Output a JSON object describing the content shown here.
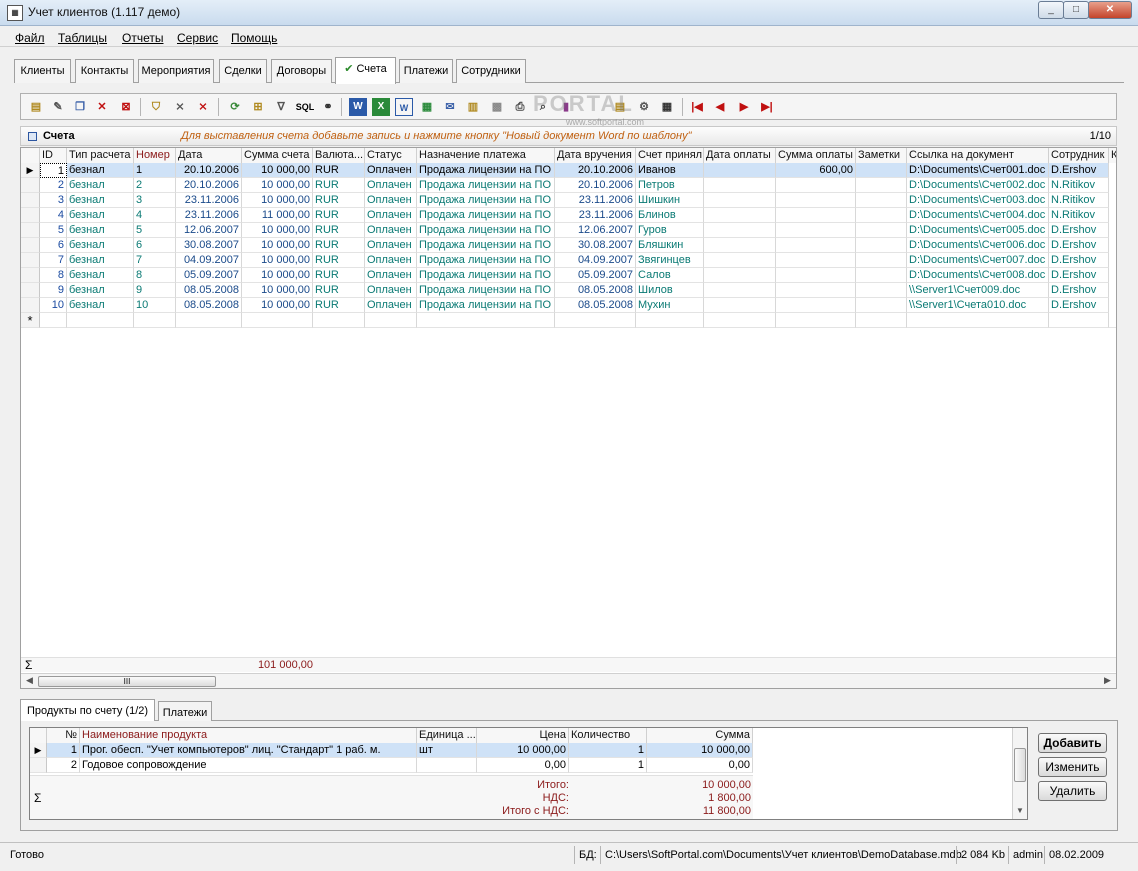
{
  "window": {
    "title": "Учет клиентов (1.117 демо)"
  },
  "menu": [
    "Файл",
    "Таблицы",
    "Отчеты",
    "Сервис",
    "Помощь"
  ],
  "tabs": [
    {
      "label": "Клиенты"
    },
    {
      "label": "Контакты"
    },
    {
      "label": "Мероприятия"
    },
    {
      "label": "Сделки"
    },
    {
      "label": "Договоры"
    },
    {
      "label": "Счета",
      "active": true
    },
    {
      "label": "Платежи"
    },
    {
      "label": "Сотрудники"
    }
  ],
  "toolbar_icons": [
    "new-icon",
    "edit-icon",
    "copy-icon",
    "delete-icon",
    "delete-all-icon",
    "filter-icon",
    "filter-clear-icon",
    "filter-remove-icon",
    "refresh-icon",
    "tree-icon",
    "filter-funnel-icon",
    "sql-icon",
    "binoculars-icon",
    "word-icon",
    "excel-icon",
    "word-template-icon",
    "export-icon",
    "mail-icon",
    "notes-icon",
    "grid-icon",
    "print-icon",
    "preview-icon",
    "chart-icon",
    "layout-icon",
    "settings-icon",
    "table-icon",
    "first-record-icon",
    "prev-record-icon",
    "next-record-icon",
    "last-record-icon"
  ],
  "watermark": {
    "text": "PORTAL",
    "url": "www.softportal.com"
  },
  "invoices": {
    "title": "Счета",
    "hint": "Для выставления счета добавьте запись и нажмите кнопку \"Новый документ Word по шаблону\"",
    "counter": "1/10",
    "columns": [
      "ID",
      "Тип расчета",
      "Номер",
      "Дата",
      "Сумма счета",
      "Валюта...",
      "Статус",
      "Назначение платежа",
      "Дата вручения",
      "Счет принял",
      "Дата оплаты",
      "Сумма оплаты",
      "Заметки",
      "Ссылка на документ",
      "Сотрудник",
      "К"
    ],
    "rows": [
      [
        "1",
        "безнал",
        "1",
        "20.10.2006",
        "10 000,00",
        "RUR",
        "Оплачен",
        "Продажа лицензии на ПО",
        "20.10.2006",
        "Иванов",
        "",
        "600,00",
        "",
        "D:\\Documents\\Счет001.doc",
        "D.Ershov"
      ],
      [
        "2",
        "безнал",
        "2",
        "20.10.2006",
        "10 000,00",
        "RUR",
        "Оплачен",
        "Продажа лицензии на ПО",
        "20.10.2006",
        "Петров",
        "",
        "",
        "",
        "D:\\Documents\\Счет002.doc",
        "N.Ritikov"
      ],
      [
        "3",
        "безнал",
        "3",
        "23.11.2006",
        "10 000,00",
        "RUR",
        "Оплачен",
        "Продажа лицензии на ПО",
        "23.11.2006",
        "Шишкин",
        "",
        "",
        "",
        "D:\\Documents\\Счет003.doc",
        "N.Ritikov"
      ],
      [
        "4",
        "безнал",
        "4",
        "23.11.2006",
        "11 000,00",
        "RUR",
        "Оплачен",
        "Продажа лицензии на ПО",
        "23.11.2006",
        "Блинов",
        "",
        "",
        "",
        "D:\\Documents\\Счет004.doc",
        "N.Ritikov"
      ],
      [
        "5",
        "безнал",
        "5",
        "12.06.2007",
        "10 000,00",
        "RUR",
        "Оплачен",
        "Продажа лицензии на ПО",
        "12.06.2007",
        "Гуров",
        "",
        "",
        "",
        "D:\\Documents\\Счет005.doc",
        "D.Ershov"
      ],
      [
        "6",
        "безнал",
        "6",
        "30.08.2007",
        "10 000,00",
        "RUR",
        "Оплачен",
        "Продажа лицензии на ПО",
        "30.08.2007",
        "Бляшкин",
        "",
        "",
        "",
        "D:\\Documents\\Счет006.doc",
        "D.Ershov"
      ],
      [
        "7",
        "безнал",
        "7",
        "04.09.2007",
        "10 000,00",
        "RUR",
        "Оплачен",
        "Продажа лицензии на ПО",
        "04.09.2007",
        "Звягинцев",
        "",
        "",
        "",
        "D:\\Documents\\Счет007.doc",
        "D.Ershov"
      ],
      [
        "8",
        "безнал",
        "8",
        "05.09.2007",
        "10 000,00",
        "RUR",
        "Оплачен",
        "Продажа лицензии на ПО",
        "05.09.2007",
        "Салов",
        "",
        "",
        "",
        "D:\\Documents\\Счет008.doc",
        "D.Ershov"
      ],
      [
        "9",
        "безнал",
        "9",
        "08.05.2008",
        "10 000,00",
        "RUR",
        "Оплачен",
        "Продажа лицензии на ПО",
        "08.05.2008",
        "Шилов",
        "",
        "",
        "",
        "\\\\Server1\\Счет009.doc",
        "D.Ershov"
      ],
      [
        "10",
        "безнал",
        "10",
        "08.05.2008",
        "10 000,00",
        "RUR",
        "Оплачен",
        "Продажа лицензии на ПО",
        "08.05.2008",
        "Мухин",
        "",
        "",
        "",
        "\\\\Server1\\Счета010.doc",
        "D.Ershov"
      ]
    ],
    "new_row_marker": "*",
    "sum_marker": "Σ",
    "total_sum": "101 000,00",
    "hscroll_grip": "III"
  },
  "bottom_tabs": [
    {
      "label": "Продукты по счету (1/2)",
      "active": true
    },
    {
      "label": "Платежи"
    }
  ],
  "products": {
    "columns": [
      "№",
      "Наименование продукта",
      "Единица ...",
      "Цена",
      "Количество",
      "Сумма"
    ],
    "rows": [
      [
        "1",
        "Прог. обесп. \"Учет компьютеров\" лиц. \"Стандарт\" 1 раб. м.",
        "шт",
        "10 000,00",
        "1",
        "10 000,00"
      ],
      [
        "2",
        "Годовое сопровождение",
        "",
        "0,00",
        "1",
        "0,00"
      ]
    ],
    "sum_marker": "Σ",
    "totals": [
      {
        "label": "Итого:",
        "value": "10 000,00"
      },
      {
        "label": "НДС:",
        "value": "1 800,00"
      },
      {
        "label": "Итого с НДС:",
        "value": "11 800,00"
      }
    ]
  },
  "buttons": {
    "add": "Добавить",
    "edit": "Изменить",
    "delete": "Удалить"
  },
  "status": {
    "state": "Готово",
    "db_label": "БД:",
    "db_path": "C:\\Users\\SoftPortal.com\\Documents\\Учет клиентов\\DemoDatabase.mdb",
    "db_size": "2 084 Kb",
    "user": "admin",
    "date": "08.02.2009"
  }
}
